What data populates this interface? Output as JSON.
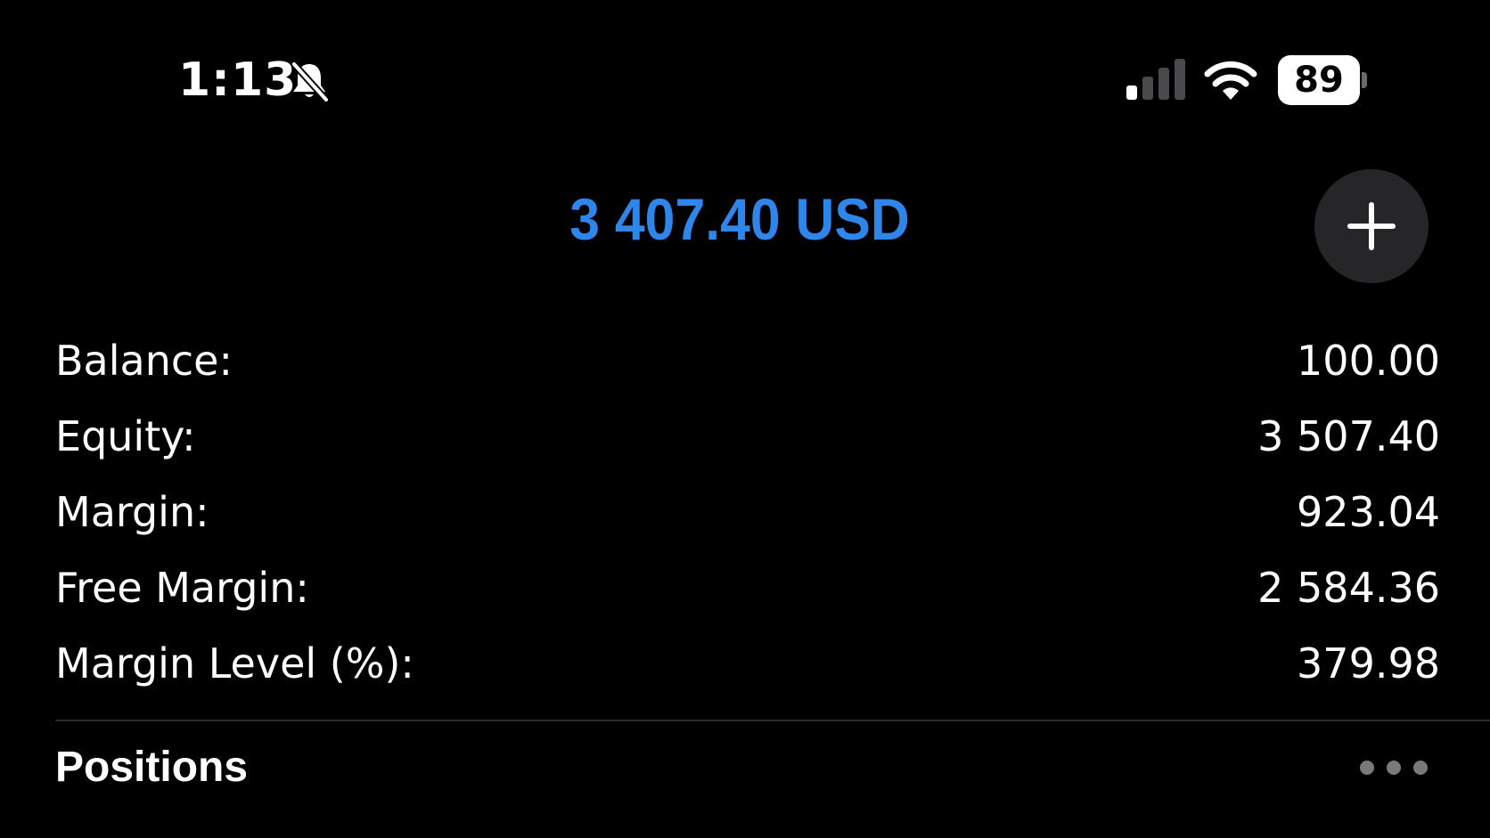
{
  "status_bar": {
    "time": "1:13",
    "battery_level": "89",
    "icons": [
      "bell-slash-icon",
      "cellular-signal-icon",
      "wifi-icon",
      "battery-icon"
    ],
    "signal_bars_active": 1,
    "signal_bars_total": 4
  },
  "header": {
    "total_equity": "3 407.40 USD",
    "add_icon": "plus-icon",
    "accent_color": "#2f86ea"
  },
  "account": {
    "rows": [
      {
        "label": "Balance:",
        "value": "100.00"
      },
      {
        "label": "Equity:",
        "value": "3 507.40"
      },
      {
        "label": "Margin:",
        "value": "923.04"
      },
      {
        "label": "Free Margin:",
        "value": "2 584.36"
      },
      {
        "label": "Margin Level (%):",
        "value": "379.98"
      }
    ]
  },
  "positions": {
    "title": "Positions",
    "more_icon": "more-dots-icon"
  }
}
